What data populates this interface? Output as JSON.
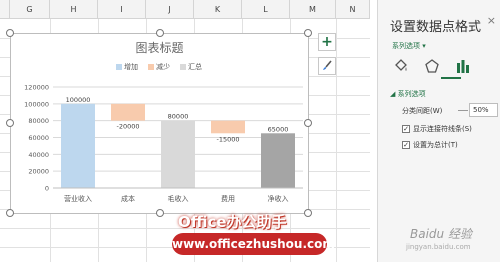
{
  "sheet": {
    "columns": [
      "G",
      "H",
      "I",
      "J",
      "K",
      "L",
      "M",
      "N"
    ]
  },
  "chart_data": {
    "type": "bar",
    "title": "图表标题",
    "legend": [
      "增加",
      "减少",
      "汇总"
    ],
    "legend_position": "top",
    "categories": [
      "营业收入",
      "成本",
      "毛收入",
      "费用",
      "净收入"
    ],
    "data_labels": [
      "100000",
      "-20000",
      "80000",
      "-15000",
      "65000"
    ],
    "y_ticks": [
      "0",
      "20000",
      "40000",
      "60000",
      "80000",
      "100000",
      "120000"
    ],
    "ylim": [
      0,
      120000
    ],
    "series": [
      {
        "name": "增加",
        "values": [
          100000,
          null,
          null,
          null,
          null
        ]
      },
      {
        "name": "减少",
        "values": [
          null,
          [
            80000,
            100000
          ],
          null,
          [
            65000,
            80000
          ],
          null
        ]
      },
      {
        "name": "汇总",
        "values": [
          null,
          null,
          80000,
          null,
          65000
        ]
      }
    ],
    "colors": {
      "增加": "#bdd7ee",
      "减少": "#f8cbad",
      "汇总_light": "#d9d9d9",
      "汇总_dark": "#a5a5a5"
    }
  },
  "side_buttons": {
    "add": "+",
    "style": "brush-icon"
  },
  "panel": {
    "title": "设置数据点格式",
    "close": "×",
    "series_dropdown": "系列选项 ▾",
    "section_header": "◢ 系列选项",
    "gap_label": "分类间距(W)",
    "gap_value": "50%",
    "show_connectors": "显示连接符线条(S)",
    "set_as_total": "设置为总计(T)"
  },
  "watermark": {
    "brand": "Office办公助手",
    "url": "www.officezhushou.com",
    "baidu": "Baidu 经验",
    "baidu_url": "jingyan.baidu.com"
  }
}
